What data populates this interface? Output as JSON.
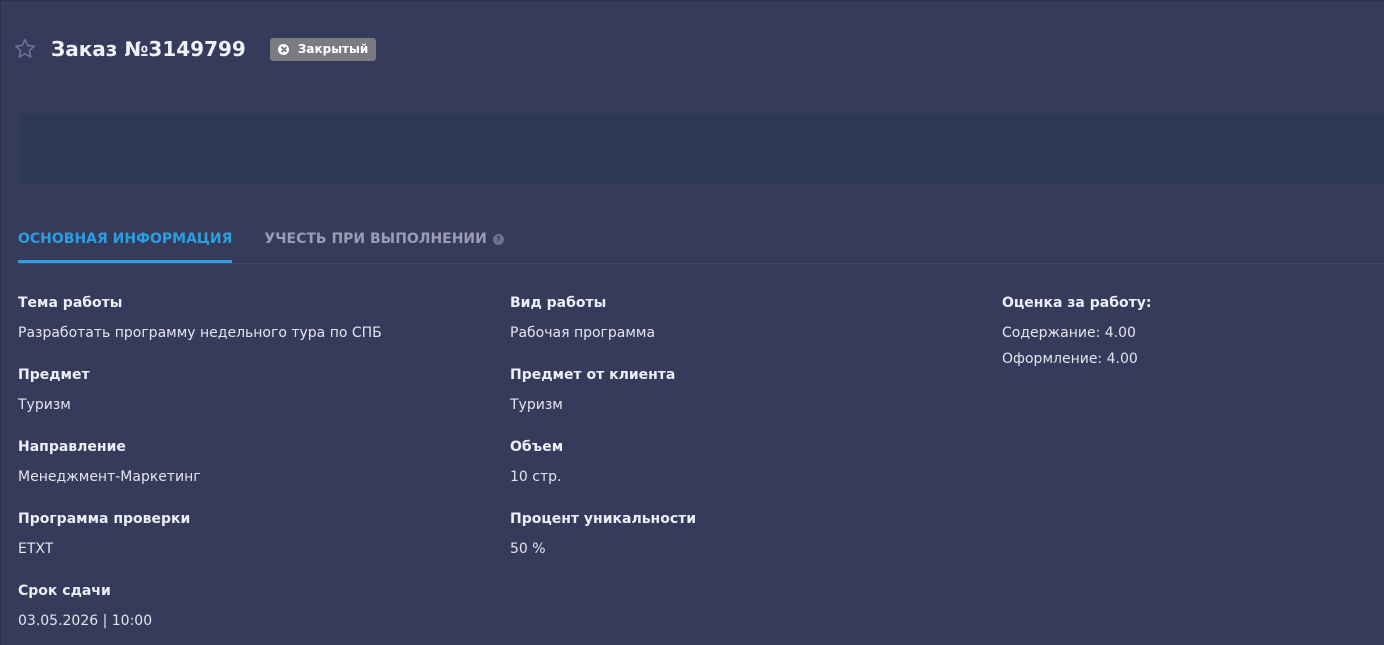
{
  "header": {
    "title": "Заказ №3149799",
    "status_label": "Закрытый"
  },
  "tabs": [
    {
      "label": "ОСНОВНАЯ ИНФОРМАЦИЯ",
      "active": true
    },
    {
      "label": "УЧЕСТЬ ПРИ ВЫПОЛНЕНИИ",
      "active": false
    }
  ],
  "fields": {
    "topic": {
      "label": "Тема работы",
      "value": "Разработать программу недельного тура по СПБ"
    },
    "subject": {
      "label": "Предмет",
      "value": "Туризм"
    },
    "direction": {
      "label": "Направление",
      "value": "Менеджмент-Маркетинг"
    },
    "check_program": {
      "label": "Программа проверки",
      "value": "ETXT"
    },
    "deadline": {
      "label": "Срок сдачи",
      "value": "03.05.2026 | 10:00"
    },
    "work_type": {
      "label": "Вид работы",
      "value": "Рабочая программа"
    },
    "client_subject": {
      "label": "Предмет от клиента",
      "value": "Туризм"
    },
    "volume": {
      "label": "Объем",
      "value": "10 стр."
    },
    "uniqueness": {
      "label": "Процент уникальности",
      "value": "50 %"
    },
    "rating": {
      "label": "Оценка за работу:",
      "content": "Содержание: 4.00",
      "design": "Оформление: 4.00"
    }
  },
  "colors": {
    "background": "#363a5b",
    "accent": "#2a9fe0",
    "badge": "#7b7b83",
    "banner": "#2e3a54"
  },
  "icons": {
    "favorite": "star-outline-icon",
    "status": "close-circle-icon",
    "help": "question-circle-icon"
  }
}
